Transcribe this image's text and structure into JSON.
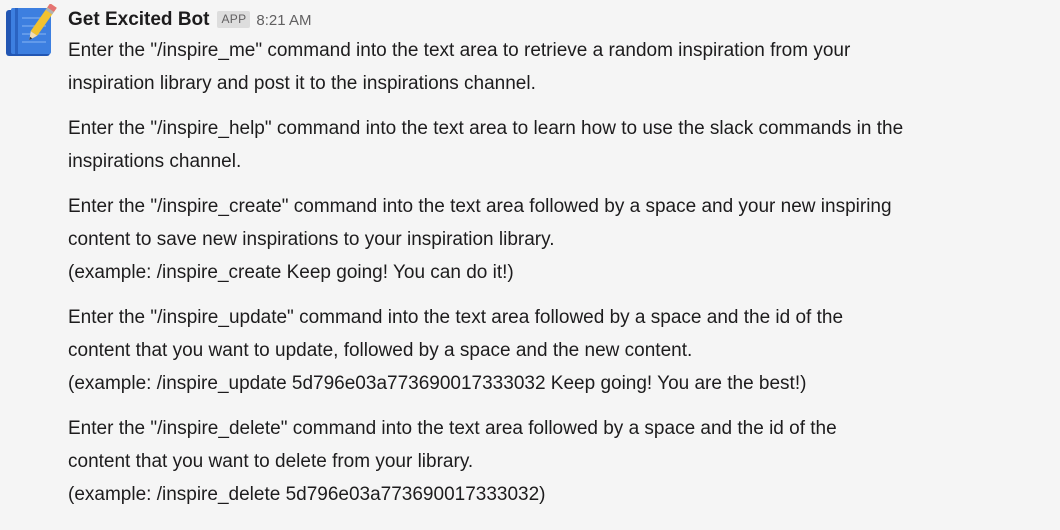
{
  "message": {
    "sender": "Get Excited Bot",
    "badge": "APP",
    "time": "8:21 AM",
    "avatar_icon": "notebook-pencil-icon",
    "paragraphs": [
      {
        "lines": [
          "Enter the \"/inspire_me\" command into the text area to retrieve a random inspiration  from your",
          "inspiration library and post it to the inspirations channel."
        ]
      },
      {
        "lines": [
          "Enter the \"/inspire_help\" command into the text area to learn how to use the slack commands in the",
          "inspirations channel."
        ]
      },
      {
        "lines": [
          "Enter the \"/inspire_create\" command into the text area followed by a space and your new inspiring",
          "content to save new inspirations to your inspiration library.",
          "(example: /inspire_create Keep going! You can do it!)"
        ]
      },
      {
        "lines": [
          "Enter the \"/inspire_update\" command into the text area followed by a space and the id of the",
          "content that you want to update, followed by a space and the new content.",
          "(example: /inspire_update 5d796e03a773690017333032 Keep going! You are the best!)"
        ]
      },
      {
        "lines": [
          "Enter the \"/inspire_delete\" command into the text area followed by a space and the id of the",
          "content that you want to delete from your library.",
          "(example: /inspire_delete 5d796e03a773690017333032)"
        ]
      }
    ]
  },
  "colors": {
    "background": "#f5f5f5",
    "text": "#1d1c1d",
    "muted": "#616061",
    "badge_bg": "#dddddd",
    "notebook_blue": "#2f6fd6",
    "pencil_yellow": "#f2c230"
  }
}
